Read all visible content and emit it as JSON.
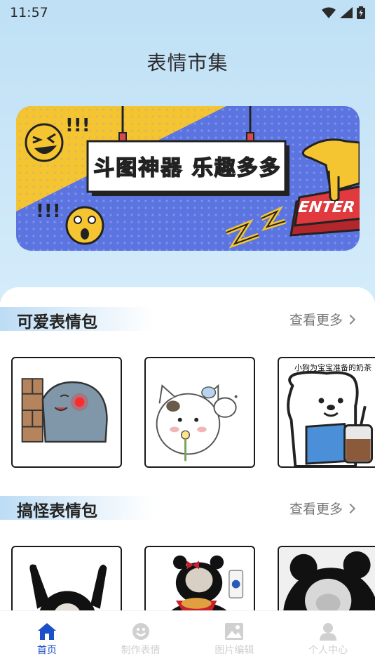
{
  "status_bar": {
    "time": "11:57"
  },
  "header": {
    "title": "表情市集"
  },
  "banner": {
    "title": "斗图神器 乐趣多多",
    "enter_label": "ENTER"
  },
  "sections": [
    {
      "title": "可爱表情包",
      "more_label": "查看更多",
      "stickers": [
        {
          "icon": "grey-blob-peeking-wall-sticker",
          "caption": ""
        },
        {
          "icon": "white-cat-holding-flower-sticker",
          "caption": ""
        },
        {
          "icon": "dog-with-milk-tea-sticker",
          "caption": "小狗为宝宝准备的奶茶"
        }
      ]
    },
    {
      "title": "搞怪表情包",
      "more_label": "查看更多",
      "stickers": [
        {
          "icon": "panda-arms-up-sticker",
          "caption": ""
        },
        {
          "icon": "panda-with-fried-chicken-sticker",
          "caption": ""
        },
        {
          "icon": "panda-face-closeup-sticker",
          "caption": ""
        }
      ]
    }
  ],
  "bottom_nav": {
    "items": [
      {
        "label": "首页",
        "icon": "home-icon",
        "active": true
      },
      {
        "label": "制作表情",
        "icon": "smiley-icon",
        "active": false
      },
      {
        "label": "图片编辑",
        "icon": "image-icon",
        "active": false
      },
      {
        "label": "个人中心",
        "icon": "person-icon",
        "active": false
      }
    ]
  },
  "colors": {
    "accent": "#1c50c8",
    "banner_yellow": "#f5c531",
    "banner_blue": "#5b74e0"
  }
}
